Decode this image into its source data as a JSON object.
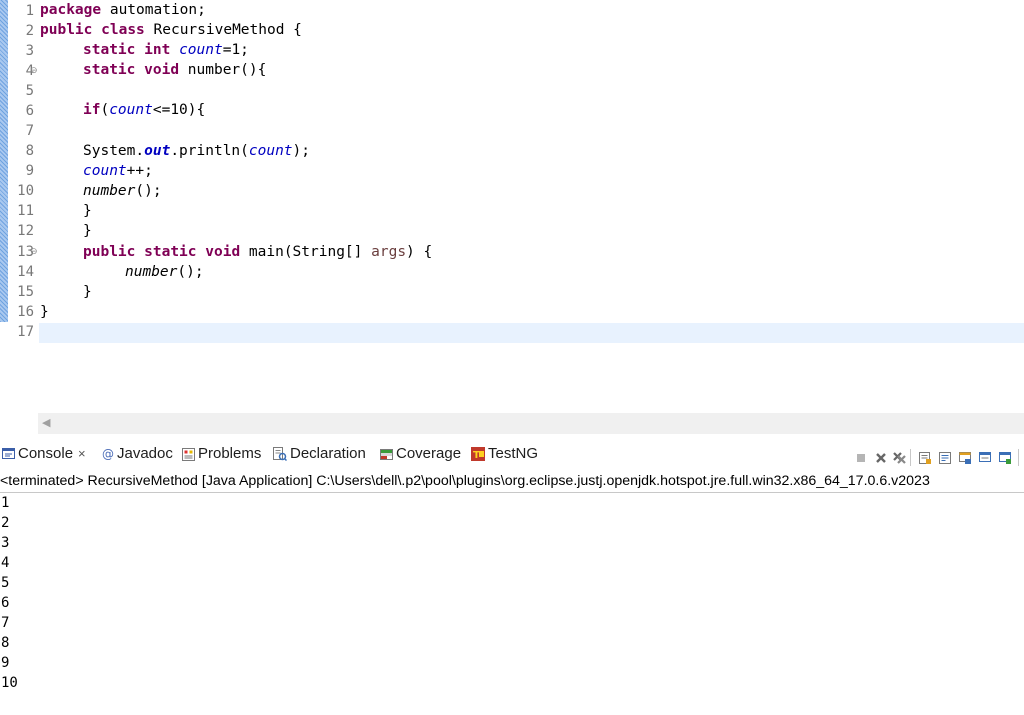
{
  "editor": {
    "line_numbers": [
      "1",
      "2",
      "3",
      "4",
      "5",
      "6",
      "7",
      "8",
      "9",
      "10",
      "11",
      "12",
      "13",
      "14",
      "15",
      "16",
      "17"
    ],
    "code": {
      "l1_kw": "package",
      "l1_rest": " automation;",
      "l2_kw1": "public",
      "l2_kw2": "class",
      "l2_rest": " RecursiveMethod {",
      "l3_kw1": "static",
      "l3_kw2": "int",
      "l3_field": "count",
      "l3_rest": "=1;",
      "l4_kw1": "static",
      "l4_kw2": "void",
      "l4_rest": " number(){",
      "l6_kw": "if",
      "l6_open": "(",
      "l6_field": "count",
      "l6_rest": "<=10){",
      "l8_pre": "System.",
      "l8_field": "out",
      "l8_mid": ".println(",
      "l8_field2": "count",
      "l8_post": ");",
      "l9_field": "count",
      "l9_post": "++;",
      "l10_call": "number",
      "l10_post": "();",
      "l11": "}",
      "l12": "}",
      "l13_kw1": "public",
      "l13_kw2": "static",
      "l13_kw3": "void",
      "l13_mid": " main(String[] ",
      "l13_param": "args",
      "l13_post": ") {",
      "l14_call": "number",
      "l14_post": "();",
      "l15": "}",
      "l16": "}"
    }
  },
  "console": {
    "tabs": [
      {
        "label": "Console",
        "close": "×"
      },
      {
        "label": "Javadoc"
      },
      {
        "label": "Problems"
      },
      {
        "label": "Declaration"
      },
      {
        "label": "Coverage"
      },
      {
        "label": "TestNG"
      }
    ],
    "status": "<terminated> RecursiveMethod [Java Application] C:\\Users\\dell\\.p2\\pool\\plugins\\org.eclipse.justj.openjdk.hotspot.jre.full.win32.x86_64_17.0.6.v2023",
    "output": [
      "1",
      "2",
      "3",
      "4",
      "5",
      "6",
      "7",
      "8",
      "9",
      "10"
    ],
    "toolbar_icons": [
      "terminate-icon",
      "remove-launch-icon",
      "remove-all-terminated-icon",
      "scroll-lock-icon",
      "word-wrap-icon",
      "pin-console-icon",
      "display-selected-console-icon",
      "open-console-icon"
    ]
  },
  "colors": {
    "keyword": "#7f0055",
    "field": "#0000c0",
    "parameter": "#6a3e3e",
    "current_line": "#e8f2fe",
    "change_bar": "#6fa3e0"
  }
}
